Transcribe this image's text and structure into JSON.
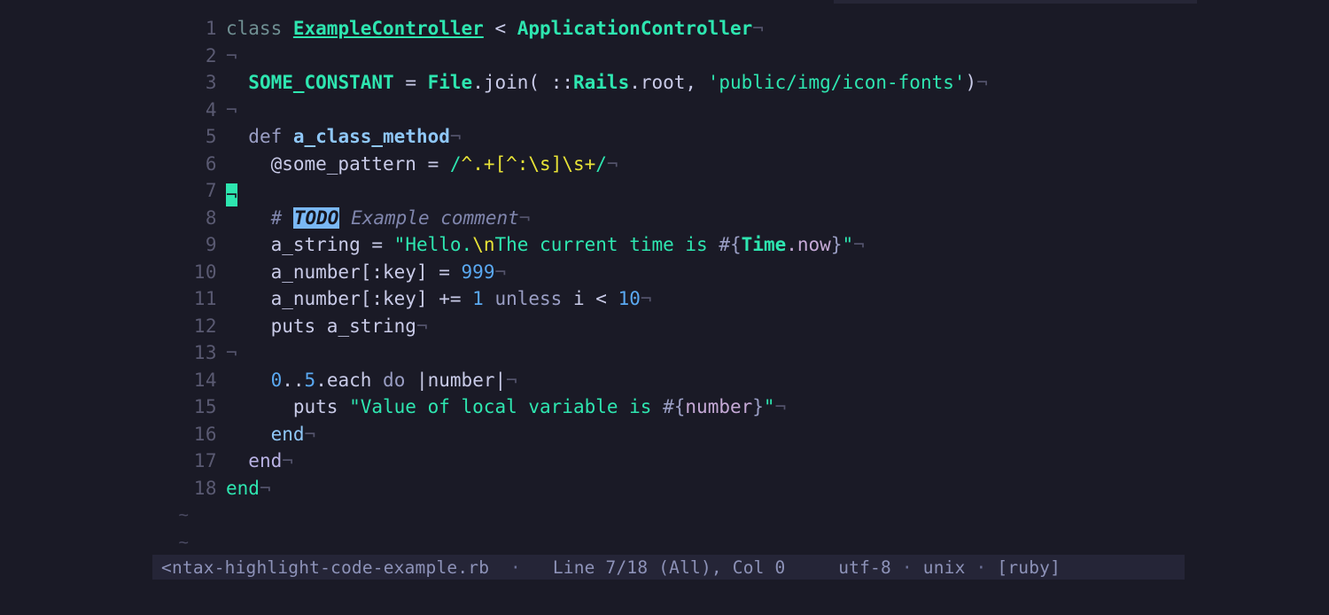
{
  "app": {
    "kind": "terminal-text-editor",
    "background": "#1a1a26",
    "accent": "#2ee6b0"
  },
  "editor": {
    "eol_marker": "¬",
    "empty_line_marker": "~",
    "empty_markers": [
      "~",
      "~"
    ],
    "cursor": {
      "line": 7,
      "col": 0,
      "glyph": "¬",
      "color": "#2ee6b0"
    },
    "line_numbers": [
      "1",
      "2",
      "3",
      "4",
      "5",
      "6",
      "7",
      "8",
      "9",
      "10",
      "11",
      "12",
      "13",
      "14",
      "15",
      "16",
      "17",
      "18"
    ],
    "lines": {
      "l1": {
        "num": "1",
        "text": "class ExampleController < ApplicationController¬"
      },
      "l2": {
        "num": "2",
        "text": "¬"
      },
      "l3": {
        "num": "3",
        "text": "  SOME_CONSTANT = File.join( ::Rails.root, 'public/img/icon-fonts')¬"
      },
      "l4": {
        "num": "4",
        "text": "¬"
      },
      "l5": {
        "num": "5",
        "text": "  def a_class_method¬"
      },
      "l6": {
        "num": "6",
        "text": "    @some_pattern = /^.+[^:\\s]\\s+/¬"
      },
      "l7": {
        "num": "7",
        "text": "¬"
      },
      "l8": {
        "num": "8",
        "text": "    # TODO Example comment¬"
      },
      "l9": {
        "num": "9",
        "text": "    a_string = \"Hello.\\nThe current time is #{Time.now}\"¬"
      },
      "l10": {
        "num": "10",
        "text": "    a_number[:key] = 999¬"
      },
      "l11": {
        "num": "11",
        "text": "    a_number[:key] += 1 unless i < 10¬"
      },
      "l12": {
        "num": "12",
        "text": "    puts a_string¬"
      },
      "l13": {
        "num": "13",
        "text": "¬"
      },
      "l14": {
        "num": "14",
        "text": "    0..5.each do |number|¬"
      },
      "l15": {
        "num": "15",
        "text": "      puts \"Value of local variable is #{number}\"¬"
      },
      "l16": {
        "num": "16",
        "text": "    end¬"
      },
      "l17": {
        "num": "17",
        "text": "  end¬"
      },
      "l18": {
        "num": "18",
        "text": "end¬"
      }
    },
    "tokens": {
      "kw_class": "class",
      "const_example_controller": "ExampleController",
      "op_lt": " < ",
      "const_application_controller": "ApplicationController",
      "const_some_constant": "SOME_CONSTANT",
      "op_assign": " = ",
      "const_file": "File",
      "call_join": ".join( ",
      "scope_op": "::",
      "const_rails": "Rails",
      "call_root": ".root, ",
      "str_path": "'public/img/icon-fonts'",
      "paren_close": ")",
      "kw_def": "def ",
      "method_name": "a_class_method",
      "ivar_some_pattern": "@some_pattern",
      "regex_open": "/",
      "regex_body": "^.+[^:\\s]\\s+",
      "regex_close": "/",
      "comment_hash": "# ",
      "comment_todo": "TODO",
      "comment_rest": " Example comment",
      "var_a_string": "a_string",
      "str_quote": "\"",
      "str_hello": "Hello.",
      "esc_newline": "\\n",
      "str_the_current_time_is": "The current time is ",
      "interp_open": "#{",
      "const_time": "Time",
      "call_now": ".now",
      "interp_close": "}",
      "var_a_number_key": "a_number[:key]",
      "num_999": "999",
      "op_plus_assign": " += ",
      "num_1": "1",
      "kw_unless": " unless ",
      "var_i": "i < ",
      "num_10": "10",
      "fn_puts": "puts ",
      "num_0": "0",
      "range_op": "..",
      "num_5": "5",
      "call_each": ".each ",
      "kw_do": "do",
      "block_param": " |number|",
      "str_value_of": "Value of local variable is ",
      "interp_number": "number",
      "kw_end": "end"
    }
  },
  "statusbar": {
    "filename": "<ntax-highlight-code-example.rb",
    "sep1": "·",
    "position": "Line 7/18 (All), Col 0",
    "encoding": "utf-8",
    "sep2": "·",
    "line_ending": "unix",
    "sep3": "·",
    "filetype": "[ruby]"
  }
}
